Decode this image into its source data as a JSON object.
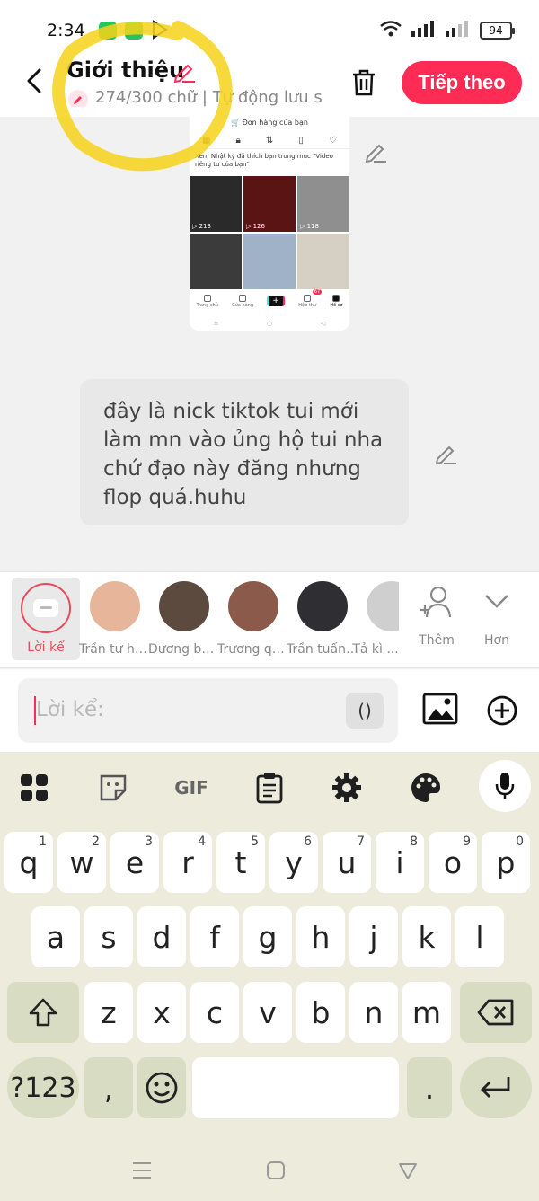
{
  "status": {
    "time": "2:34",
    "battery": "94"
  },
  "header": {
    "title": "Giới thiệu",
    "subtitle": "274/300 chữ | Tự động lưu s",
    "next_label": "Tiếp theo"
  },
  "screenshot": {
    "shop_label": "🛒 Đơn hàng của bạn",
    "notice": "Xem Nhật ký đã thích bạn trong mục \"Video riêng tư của bạn\"",
    "videos": [
      {
        "views": "▷ 213",
        "color": "#2a2a2a"
      },
      {
        "views": "▷ 126",
        "color": "#5a1414"
      },
      {
        "views": "▷ 118",
        "color": "#8f8f8f"
      },
      {
        "views": "",
        "color": "#3b3b3b"
      },
      {
        "views": "",
        "color": "#9fb2c7"
      },
      {
        "views": "",
        "color": "#d6d0c4"
      }
    ],
    "tabs": [
      "Trang chủ",
      "Cửa hàng",
      "",
      "Hộp thư",
      "Hồ sơ"
    ],
    "inbox_badge": "67"
  },
  "caption": "đây là nick tiktok tui mới làm mn vào ủng hộ tui nha chứ đạo này đăng nhưng flop quá.huhu",
  "stories": {
    "narration_label": "Lời kể",
    "avatars": [
      {
        "name": "Trần tư hã...",
        "color": "#e7b69a"
      },
      {
        "name": "Dương bá...",
        "color": "#5c4a3e"
      },
      {
        "name": "Trương qu...",
        "color": "#8b5a4a"
      },
      {
        "name": "Trần tuấn ...",
        "color": "#2e2e33"
      },
      {
        "name": "Tả kì ...",
        "color": "#cfcfcf"
      }
    ],
    "more_label": "Thêm",
    "expand_label": "Hơn"
  },
  "input": {
    "placeholder": "Lời kể:",
    "paren_label": "()"
  },
  "keyboard": {
    "row1": [
      {
        "k": "q",
        "h": "1"
      },
      {
        "k": "w",
        "h": "2"
      },
      {
        "k": "e",
        "h": "3"
      },
      {
        "k": "r",
        "h": "4"
      },
      {
        "k": "t",
        "h": "5"
      },
      {
        "k": "y",
        "h": "6"
      },
      {
        "k": "u",
        "h": "7"
      },
      {
        "k": "i",
        "h": "8"
      },
      {
        "k": "o",
        "h": "9"
      },
      {
        "k": "p",
        "h": "0"
      }
    ],
    "row2": [
      "a",
      "s",
      "d",
      "f",
      "g",
      "h",
      "j",
      "k",
      "l"
    ],
    "row3": [
      "z",
      "x",
      "c",
      "v",
      "b",
      "n",
      "m"
    ],
    "symbols_label": "?123",
    "comma_label": ",",
    "period_label": ".",
    "gif_label": "GIF"
  }
}
